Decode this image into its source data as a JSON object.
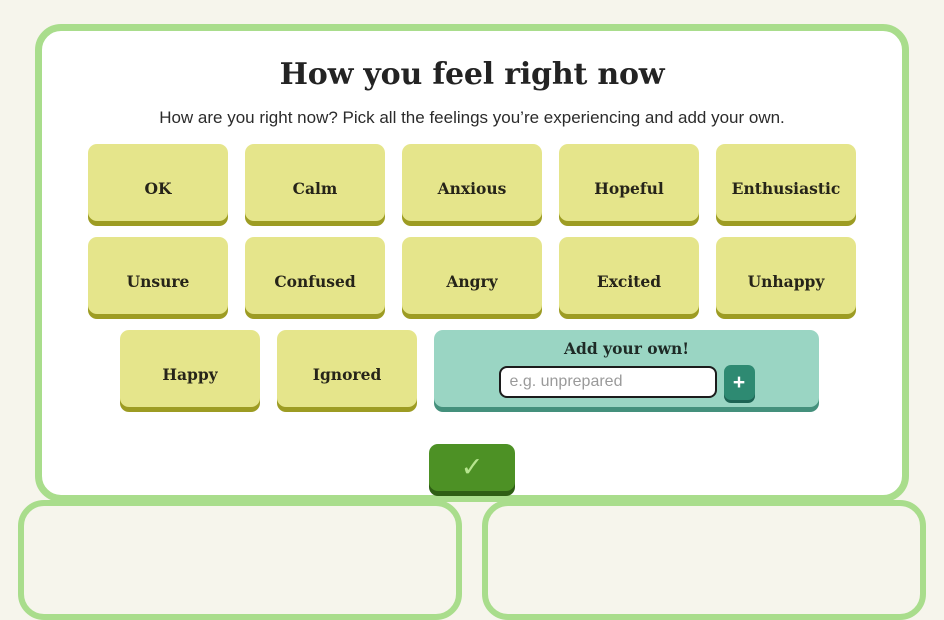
{
  "page": {
    "background_color": "#f6f5ec",
    "card_border_color": "#a9dd8c",
    "card_background": "#ffffff"
  },
  "header": {
    "title": "How you feel right now",
    "subtitle": "How are you right now? Pick all the feelings you’re experiencing and add your own."
  },
  "feelings": {
    "button_color": "#e5e58b",
    "button_shadow_color": "#9d9c23",
    "row1": [
      {
        "label": "OK"
      },
      {
        "label": "Calm"
      },
      {
        "label": "Anxious"
      },
      {
        "label": "Hopeful"
      },
      {
        "label": "Enthusiastic"
      }
    ],
    "row2": [
      {
        "label": "Unsure"
      },
      {
        "label": "Confused"
      },
      {
        "label": "Angry"
      },
      {
        "label": "Excited"
      },
      {
        "label": "Unhappy"
      }
    ],
    "row3": [
      {
        "label": "Happy"
      },
      {
        "label": "Ignored"
      }
    ]
  },
  "add_own": {
    "label": "Add your own!",
    "input_value": "",
    "placeholder": "e.g. unprepared",
    "add_button_label": "+",
    "panel_color": "#9ad5c3",
    "panel_shadow_color": "#44907c",
    "add_button_color": "#2e8a72"
  },
  "submit": {
    "icon": "check-icon",
    "glyph": "✓",
    "color": "#4d9125",
    "shadow_color": "#2e5e14",
    "check_color": "#b6e58e"
  }
}
